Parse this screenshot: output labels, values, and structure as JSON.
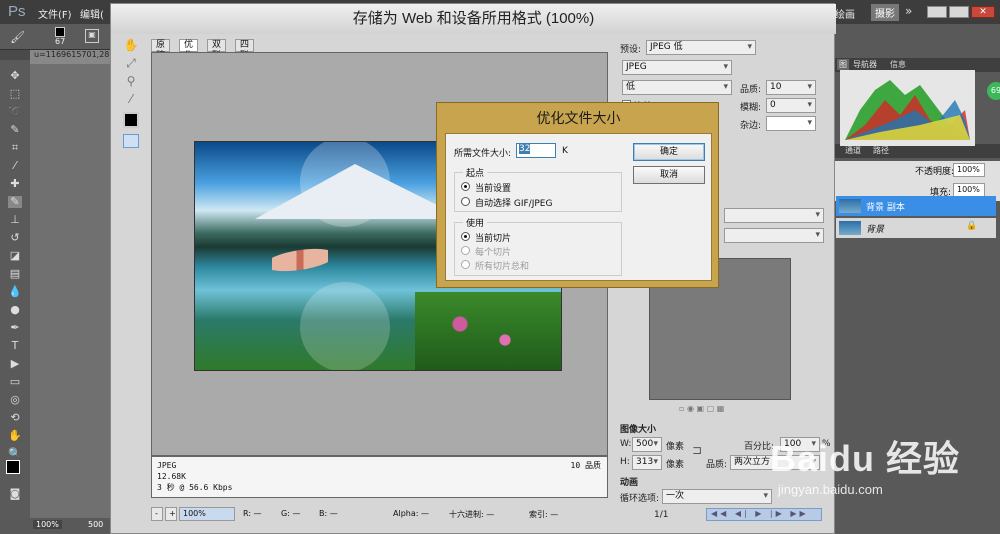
{
  "photoshop": {
    "logo": "Ps",
    "menus": [
      "文件(F)",
      "编辑("
    ],
    "top_right_label": "绘画",
    "mode_chip": "摄影",
    "brush_size": "67",
    "doc_tab": "u=1169615701,28",
    "status_zoom": "100%",
    "status_doc": "500",
    "panels": {
      "histogram_tabs": [
        "图",
        "导航器",
        "信息"
      ],
      "channels_tabs": [
        "通道",
        "路径"
      ],
      "opacity_label": "不透明度:",
      "opacity_value": "100%",
      "fill_label": "填充:",
      "fill_value": "100%",
      "layers": [
        "背景 副本",
        "背景"
      ],
      "badge": "69"
    },
    "watermark": {
      "brand": "Baidu 经验",
      "url": "jingyan.baidu.com"
    }
  },
  "save_for_web": {
    "title": "存储为 Web 和设备所用格式 (100%)",
    "tabs": [
      "原稿",
      "优化",
      "双联",
      "四联"
    ],
    "active_tab": "优化",
    "info": {
      "format": "JPEG",
      "size": "12.68K",
      "speed": "3 秒 @ 56.6 Kbps",
      "quality": "10 品质"
    },
    "bottom": {
      "zoom": "100%",
      "r": "R: —",
      "g": "G: —",
      "b": "B: —",
      "alpha": "Alpha: —",
      "hex": "十六进制: —",
      "index": "索引: —"
    },
    "right_panel": {
      "preset_label": "预设:",
      "preset_value": "JPEG 低",
      "format_value": "JPEG",
      "quality_level": "低",
      "quality_label": "品质:",
      "quality_value": "10",
      "progressive_label": "连续",
      "blur_label": "模糊:",
      "blur_value": "0",
      "matte_label": "杂边:",
      "image_size_title": "图像大小",
      "w_label": "W:",
      "w_value": "500",
      "h_label": "H:",
      "h_value": "313",
      "px": "像素",
      "percent_label": "百分比:",
      "percent_value": "100",
      "percent_unit": "%",
      "resample_label": "品质:",
      "resample_value": "两次立方",
      "animation_title": "动画",
      "loop_label": "循环选项:",
      "loop_value": "一次",
      "frame_counter": "1/1"
    }
  },
  "optimize_dialog": {
    "title": "优化文件大小",
    "size_label": "所需文件大小:",
    "size_value": "32",
    "size_unit": "K",
    "ok_label": "确定",
    "cancel_label": "取消",
    "start_group": "起点",
    "start_options": [
      "当前设置",
      "自动选择 GIF/JPEG"
    ],
    "use_group": "使用",
    "use_options": [
      "当前切片",
      "每个切片",
      "所有切片总和"
    ]
  }
}
